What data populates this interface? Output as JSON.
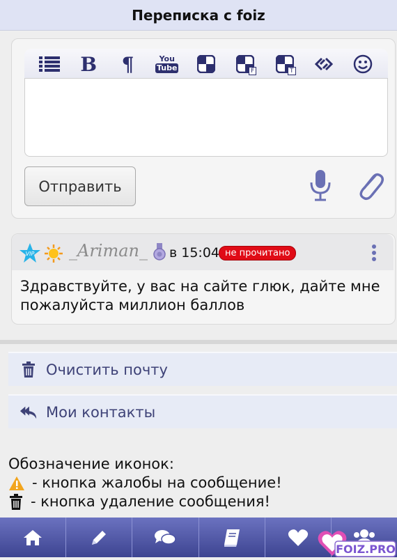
{
  "header": {
    "title": "Переписка с foiz"
  },
  "editor": {
    "toolbar": [
      {
        "name": "list-icon"
      },
      {
        "name": "bold-icon",
        "glyph": "B"
      },
      {
        "name": "paragraph-icon",
        "glyph": "¶"
      },
      {
        "name": "youtube-icon",
        "text_top": "You",
        "text_bottom": "Tube"
      },
      {
        "name": "quote-icon"
      },
      {
        "name": "quote-f-icon",
        "letter": "F"
      },
      {
        "name": "quote-t-icon",
        "letter": "T"
      },
      {
        "name": "link-icon"
      },
      {
        "name": "smiley-icon"
      }
    ],
    "send_label": "Отправить"
  },
  "message": {
    "username": "_Ariman_",
    "vip_label": "VIP",
    "time": "в 15:04",
    "status_badge": "не прочитано",
    "text": "Здравствуйте, у вас на сайте глюк, дайте мне пожалуйста миллион баллов"
  },
  "actions": {
    "clear_mail": "Очистить почту",
    "contacts": "Мои контакты"
  },
  "legend": {
    "title": "Обозначение иконок:",
    "complaint": "- кнопка жалобы на сообщение!",
    "delete": "- кнопка удаление сообщения!"
  },
  "bottom_nav": [
    "home-icon",
    "pencil-icon",
    "chat-icon",
    "book-icon",
    "heart-icon",
    "users-icon"
  ],
  "logo": {
    "text": "FOIZ.PRO"
  },
  "colors": {
    "header_bg": "#dfe3f4",
    "nav_bg": "#4b52a3",
    "badge_red": "#e00b16",
    "accent": "#3e4277"
  }
}
